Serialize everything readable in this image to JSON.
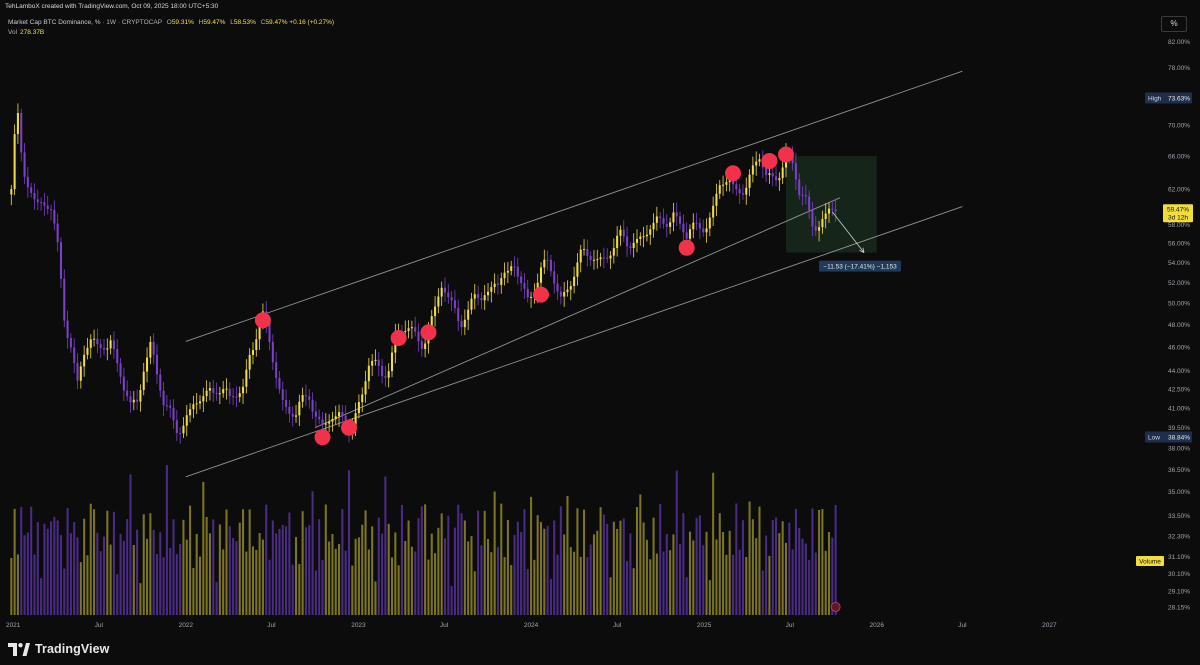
{
  "credit": "TehLamboX created with TradingView.com, Oct 09, 2025 18:00 UTC+5:30",
  "symbol": {
    "name": "Market Cap BTC Dominance, %",
    "interval": "1W",
    "exchange": "CRYPTOCAP",
    "open_label": "O",
    "open": "59.31%",
    "high_label": "H",
    "high": "59.47%",
    "low_label": "L",
    "low": "58.53%",
    "close_label": "C",
    "close": "59.47%",
    "change": "+0.16 (+0.27%)"
  },
  "volume": {
    "label": "Vol",
    "value": "278.37B"
  },
  "scale_button": "%",
  "brand": "TradingView",
  "colors": {
    "up": "#f2dd3e",
    "down": "#7b41c9",
    "vol_up": "#7d7522",
    "vol_down": "#4b2b86",
    "marker": "#f2324b",
    "channel": "#a9a9a9",
    "target_zone": "#15251a",
    "background": "#0c0c0c"
  },
  "price_axis": {
    "ticks": [
      "82.00%",
      "78.00%",
      "70.00%",
      "66.00%",
      "62.00%",
      "60.00%",
      "58.00%",
      "56.00%",
      "54.00%",
      "52.00%",
      "50.00%",
      "48.00%",
      "46.00%",
      "44.00%",
      "42.50%",
      "41.00%",
      "39.50%",
      "38.00%",
      "36.50%",
      "35.00%",
      "33.50%",
      "32.30%",
      "31.10%",
      "30.10%",
      "29.10%",
      "28.15%"
    ],
    "tick_values": [
      82,
      78,
      70,
      66,
      62,
      60,
      58,
      56,
      54,
      52,
      50,
      48,
      46,
      44,
      42.5,
      41,
      39.5,
      38,
      36.5,
      35,
      33.5,
      32.3,
      31.1,
      30.1,
      29.1,
      28.15
    ],
    "high_label": "High",
    "high_value": "73.63%",
    "low_label": "Low",
    "low_value": "38.84%",
    "current_value": "59.47%",
    "countdown": "3d 12h",
    "volume_label": "Volume"
  },
  "time_axis": {
    "labels": [
      "2021",
      "Jul",
      "2022",
      "Jul",
      "2023",
      "Jul",
      "2024",
      "Jul",
      "2025",
      "Jul",
      "2026",
      "Jul",
      "2027"
    ],
    "values": [
      "2021-01-01",
      "2021-07-01",
      "2022-01-01",
      "2022-07-01",
      "2023-01-01",
      "2023-07-01",
      "2024-01-01",
      "2024-07-01",
      "2025-01-01",
      "2025-07-01",
      "2026-01-01",
      "2026-07-01",
      "2027-01-01"
    ]
  },
  "chart_data": {
    "type": "candlestick",
    "title": "Market Cap BTC Dominance, %",
    "interval": "1W",
    "y_scale": "log",
    "ylim": [
      28.15,
      82
    ],
    "y_unit": "%",
    "close_series": {
      "name": "BTC Dominance (weekly close, %)",
      "points": [
        [
          "2020-12-28",
          62
        ],
        [
          "2021-01-04",
          68
        ],
        [
          "2021-01-11",
          70
        ],
        [
          "2021-01-18",
          65
        ],
        [
          "2021-01-25",
          63
        ],
        [
          "2021-02-08",
          63
        ],
        [
          "2021-02-22",
          61
        ],
        [
          "2021-03-08",
          60
        ],
        [
          "2021-03-22",
          59
        ],
        [
          "2021-04-05",
          55
        ],
        [
          "2021-04-19",
          49
        ],
        [
          "2021-05-03",
          47
        ],
        [
          "2021-05-17",
          43
        ],
        [
          "2021-05-31",
          45
        ],
        [
          "2021-06-14",
          46
        ],
        [
          "2021-06-28",
          46
        ],
        [
          "2021-07-12",
          47
        ],
        [
          "2021-07-26",
          47
        ],
        [
          "2021-08-09",
          44
        ],
        [
          "2021-08-23",
          42
        ],
        [
          "2021-09-06",
          41
        ],
        [
          "2021-09-20",
          42
        ],
        [
          "2021-10-04",
          45
        ],
        [
          "2021-10-18",
          46
        ],
        [
          "2021-11-01",
          43
        ],
        [
          "2021-11-15",
          41
        ],
        [
          "2021-11-29",
          41
        ],
        [
          "2021-12-13",
          40
        ],
        [
          "2021-12-27",
          40
        ],
        [
          "2022-01-10",
          40
        ],
        [
          "2022-01-24",
          41
        ],
        [
          "2022-02-07",
          42
        ],
        [
          "2022-02-21",
          43
        ],
        [
          "2022-03-07",
          43
        ],
        [
          "2022-03-21",
          42
        ],
        [
          "2022-04-04",
          41
        ],
        [
          "2022-04-18",
          42
        ],
        [
          "2022-05-02",
          43
        ],
        [
          "2022-05-16",
          46
        ],
        [
          "2022-05-30",
          47
        ],
        [
          "2022-06-13",
          48
        ],
        [
          "2022-06-27",
          46
        ],
        [
          "2022-07-11",
          44
        ],
        [
          "2022-07-25",
          42
        ],
        [
          "2022-08-08",
          41
        ],
        [
          "2022-08-22",
          40
        ],
        [
          "2022-09-05",
          41
        ],
        [
          "2022-09-19",
          42
        ],
        [
          "2022-10-03",
          41
        ],
        [
          "2022-10-17",
          40
        ],
        [
          "2022-10-31",
          40
        ],
        [
          "2022-11-14",
          39.5
        ],
        [
          "2022-11-28",
          40
        ],
        [
          "2022-12-12",
          40
        ],
        [
          "2022-12-26",
          41
        ],
        [
          "2023-01-09",
          42
        ],
        [
          "2023-01-23",
          44
        ],
        [
          "2023-02-06",
          44
        ],
        [
          "2023-02-20",
          44
        ],
        [
          "2023-03-06",
          45
        ],
        [
          "2023-03-20",
          47
        ],
        [
          "2023-04-03",
          47
        ],
        [
          "2023-04-17",
          47
        ],
        [
          "2023-05-01",
          47
        ],
        [
          "2023-05-15",
          47
        ],
        [
          "2023-05-29",
          48
        ],
        [
          "2023-06-12",
          49
        ],
        [
          "2023-06-26",
          51
        ],
        [
          "2023-07-10",
          50
        ],
        [
          "2023-07-24",
          50
        ],
        [
          "2023-08-07",
          49
        ],
        [
          "2023-08-21",
          49
        ],
        [
          "2023-09-04",
          50
        ],
        [
          "2023-09-18",
          50
        ],
        [
          "2023-10-02",
          51
        ],
        [
          "2023-10-16",
          53
        ],
        [
          "2023-10-30",
          53
        ],
        [
          "2023-11-13",
          52
        ],
        [
          "2023-11-27",
          53
        ],
        [
          "2023-12-11",
          52
        ],
        [
          "2023-12-25",
          51
        ],
        [
          "2024-01-08",
          52
        ],
        [
          "2024-01-22",
          53
        ],
        [
          "2024-02-05",
          53
        ],
        [
          "2024-02-19",
          52
        ],
        [
          "2024-03-04",
          51
        ],
        [
          "2024-03-18",
          52
        ],
        [
          "2024-04-01",
          53
        ],
        [
          "2024-04-15",
          54
        ],
        [
          "2024-04-29",
          54
        ],
        [
          "2024-05-13",
          55
        ],
        [
          "2024-05-27",
          55
        ],
        [
          "2024-06-10",
          55
        ],
        [
          "2024-06-24",
          55
        ],
        [
          "2024-07-08",
          56
        ],
        [
          "2024-07-22",
          56
        ],
        [
          "2024-08-05",
          57
        ],
        [
          "2024-08-19",
          57
        ],
        [
          "2024-09-02",
          57
        ],
        [
          "2024-09-16",
          57
        ],
        [
          "2024-09-30",
          58
        ],
        [
          "2024-10-14",
          59
        ],
        [
          "2024-10-28",
          60
        ],
        [
          "2024-11-11",
          58
        ],
        [
          "2024-11-25",
          56
        ],
        [
          "2024-12-09",
          57
        ],
        [
          "2024-12-23",
          58
        ],
        [
          "2025-01-06",
          59
        ],
        [
          "2025-01-20",
          60
        ],
        [
          "2025-02-03",
          62
        ],
        [
          "2025-02-17",
          62
        ],
        [
          "2025-03-03",
          62
        ],
        [
          "2025-03-17",
          63
        ],
        [
          "2025-03-31",
          63
        ],
        [
          "2025-04-14",
          64
        ],
        [
          "2025-04-28",
          65
        ],
        [
          "2025-05-12",
          63
        ],
        [
          "2025-05-26",
          64
        ],
        [
          "2025-06-09",
          65
        ],
        [
          "2025-06-23",
          66
        ],
        [
          "2025-07-07",
          64
        ],
        [
          "2025-07-21",
          61
        ],
        [
          "2025-08-04",
          61
        ],
        [
          "2025-08-18",
          59
        ],
        [
          "2025-09-01",
          58.5
        ],
        [
          "2025-09-15",
          58
        ],
        [
          "2025-09-29",
          59
        ],
        [
          "2025-10-06",
          59.47
        ]
      ]
    },
    "channel": {
      "upper": [
        [
          "2022-01-01",
          46.5
        ],
        [
          "2026-07-01",
          77.5
        ]
      ],
      "middle": [
        [
          "2022-10-01",
          39.5
        ],
        [
          "2025-10-15",
          61
        ]
      ],
      "lower": [
        [
          "2022-01-01",
          36
        ],
        [
          "2026-07-01",
          60
        ]
      ]
    },
    "touch_markers": [
      [
        "2022-06-13",
        48.4
      ],
      [
        "2022-10-17",
        38.8
      ],
      [
        "2022-12-12",
        39.5
      ],
      [
        "2023-03-27",
        46.8
      ],
      [
        "2023-05-29",
        47.3
      ],
      [
        "2024-01-22",
        50.8
      ],
      [
        "2024-11-25",
        55.5
      ],
      [
        "2025-03-03",
        63.9
      ],
      [
        "2025-05-19",
        65.4
      ],
      [
        "2025-06-23",
        66.2
      ]
    ],
    "target_zone": {
      "x": [
        "2025-06-23",
        "2026-01-01"
      ],
      "y": [
        55,
        66
      ]
    },
    "projection": {
      "from": [
        "2025-09-29",
        59.4
      ],
      "to": [
        "2025-12-05",
        55.0
      ],
      "label": "−11.53 (−17.41%) −1,153"
    },
    "high": 73.63,
    "low": 38.84,
    "last": 59.47
  }
}
